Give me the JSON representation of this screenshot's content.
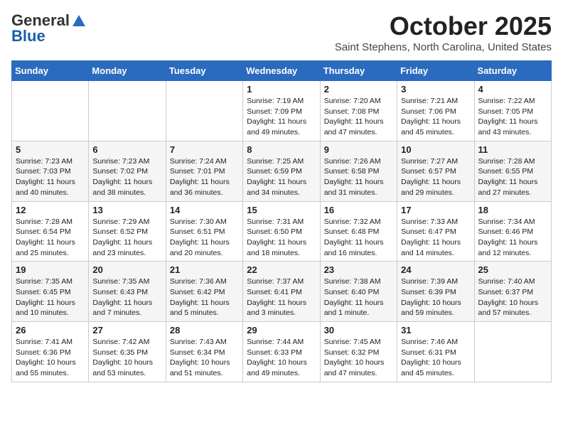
{
  "header": {
    "logo_general": "General",
    "logo_blue": "Blue",
    "month": "October 2025",
    "location": "Saint Stephens, North Carolina, United States"
  },
  "days_of_week": [
    "Sunday",
    "Monday",
    "Tuesday",
    "Wednesday",
    "Thursday",
    "Friday",
    "Saturday"
  ],
  "weeks": [
    [
      {
        "day": "",
        "info": ""
      },
      {
        "day": "",
        "info": ""
      },
      {
        "day": "",
        "info": ""
      },
      {
        "day": "1",
        "info": "Sunrise: 7:19 AM\nSunset: 7:09 PM\nDaylight: 11 hours and 49 minutes."
      },
      {
        "day": "2",
        "info": "Sunrise: 7:20 AM\nSunset: 7:08 PM\nDaylight: 11 hours and 47 minutes."
      },
      {
        "day": "3",
        "info": "Sunrise: 7:21 AM\nSunset: 7:06 PM\nDaylight: 11 hours and 45 minutes."
      },
      {
        "day": "4",
        "info": "Sunrise: 7:22 AM\nSunset: 7:05 PM\nDaylight: 11 hours and 43 minutes."
      }
    ],
    [
      {
        "day": "5",
        "info": "Sunrise: 7:23 AM\nSunset: 7:03 PM\nDaylight: 11 hours and 40 minutes."
      },
      {
        "day": "6",
        "info": "Sunrise: 7:23 AM\nSunset: 7:02 PM\nDaylight: 11 hours and 38 minutes."
      },
      {
        "day": "7",
        "info": "Sunrise: 7:24 AM\nSunset: 7:01 PM\nDaylight: 11 hours and 36 minutes."
      },
      {
        "day": "8",
        "info": "Sunrise: 7:25 AM\nSunset: 6:59 PM\nDaylight: 11 hours and 34 minutes."
      },
      {
        "day": "9",
        "info": "Sunrise: 7:26 AM\nSunset: 6:58 PM\nDaylight: 11 hours and 31 minutes."
      },
      {
        "day": "10",
        "info": "Sunrise: 7:27 AM\nSunset: 6:57 PM\nDaylight: 11 hours and 29 minutes."
      },
      {
        "day": "11",
        "info": "Sunrise: 7:28 AM\nSunset: 6:55 PM\nDaylight: 11 hours and 27 minutes."
      }
    ],
    [
      {
        "day": "12",
        "info": "Sunrise: 7:28 AM\nSunset: 6:54 PM\nDaylight: 11 hours and 25 minutes."
      },
      {
        "day": "13",
        "info": "Sunrise: 7:29 AM\nSunset: 6:52 PM\nDaylight: 11 hours and 23 minutes."
      },
      {
        "day": "14",
        "info": "Sunrise: 7:30 AM\nSunset: 6:51 PM\nDaylight: 11 hours and 20 minutes."
      },
      {
        "day": "15",
        "info": "Sunrise: 7:31 AM\nSunset: 6:50 PM\nDaylight: 11 hours and 18 minutes."
      },
      {
        "day": "16",
        "info": "Sunrise: 7:32 AM\nSunset: 6:48 PM\nDaylight: 11 hours and 16 minutes."
      },
      {
        "day": "17",
        "info": "Sunrise: 7:33 AM\nSunset: 6:47 PM\nDaylight: 11 hours and 14 minutes."
      },
      {
        "day": "18",
        "info": "Sunrise: 7:34 AM\nSunset: 6:46 PM\nDaylight: 11 hours and 12 minutes."
      }
    ],
    [
      {
        "day": "19",
        "info": "Sunrise: 7:35 AM\nSunset: 6:45 PM\nDaylight: 11 hours and 10 minutes."
      },
      {
        "day": "20",
        "info": "Sunrise: 7:35 AM\nSunset: 6:43 PM\nDaylight: 11 hours and 7 minutes."
      },
      {
        "day": "21",
        "info": "Sunrise: 7:36 AM\nSunset: 6:42 PM\nDaylight: 11 hours and 5 minutes."
      },
      {
        "day": "22",
        "info": "Sunrise: 7:37 AM\nSunset: 6:41 PM\nDaylight: 11 hours and 3 minutes."
      },
      {
        "day": "23",
        "info": "Sunrise: 7:38 AM\nSunset: 6:40 PM\nDaylight: 11 hours and 1 minute."
      },
      {
        "day": "24",
        "info": "Sunrise: 7:39 AM\nSunset: 6:39 PM\nDaylight: 10 hours and 59 minutes."
      },
      {
        "day": "25",
        "info": "Sunrise: 7:40 AM\nSunset: 6:37 PM\nDaylight: 10 hours and 57 minutes."
      }
    ],
    [
      {
        "day": "26",
        "info": "Sunrise: 7:41 AM\nSunset: 6:36 PM\nDaylight: 10 hours and 55 minutes."
      },
      {
        "day": "27",
        "info": "Sunrise: 7:42 AM\nSunset: 6:35 PM\nDaylight: 10 hours and 53 minutes."
      },
      {
        "day": "28",
        "info": "Sunrise: 7:43 AM\nSunset: 6:34 PM\nDaylight: 10 hours and 51 minutes."
      },
      {
        "day": "29",
        "info": "Sunrise: 7:44 AM\nSunset: 6:33 PM\nDaylight: 10 hours and 49 minutes."
      },
      {
        "day": "30",
        "info": "Sunrise: 7:45 AM\nSunset: 6:32 PM\nDaylight: 10 hours and 47 minutes."
      },
      {
        "day": "31",
        "info": "Sunrise: 7:46 AM\nSunset: 6:31 PM\nDaylight: 10 hours and 45 minutes."
      },
      {
        "day": "",
        "info": ""
      }
    ]
  ]
}
